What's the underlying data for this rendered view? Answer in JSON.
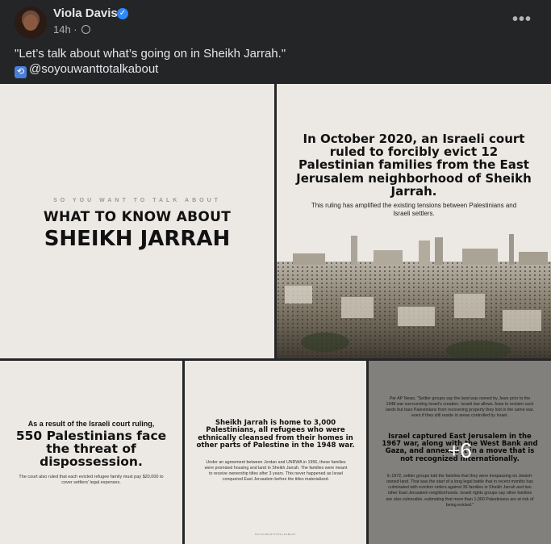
{
  "post": {
    "author": "Viola Davis",
    "time": "14h ·",
    "caption": "\"Let’s talk about what’s going on in Sheikh Jarrah.\"",
    "handle": "@soyouwanttotalkabout",
    "more_label": "•••"
  },
  "tiles": {
    "t1": {
      "kicker": "SO YOU WANT TO TALK ABOUT",
      "line1": "WHAT TO KNOW ABOUT",
      "line2": "SHEIKH JARRAH"
    },
    "t2": {
      "headline": "In October 2020, an Israeli court ruled to forcibly evict 12 Palestinian families from the East Jerusalem neighborhood of Sheikh Jarrah.",
      "sub": "This ruling has amplified the existing tensions between Palestinians and Israeli settlers."
    },
    "t3": {
      "intro": "As a result of the Israeli court ruling,",
      "headline": "550 Palestinians face the threat of dispossession.",
      "small": "The court also ruled that each evicted refugee family must pay $20,000 to cover settlers' legal expenses."
    },
    "t4": {
      "headline": "Sheikh Jarrah is home to 3,000 Palestinians, all refugees who were ethnically cleansed from their homes in other parts of Palestine in the 1948 war.",
      "small": "Under an agreement between Jordan and UNRWA in 1956, these families were promised housing and land in Sheikh Jarrah. The families were meant to receive ownership titles after 3 years. This never happened as Israel conquered East Jerusalem before the titles materialized.",
      "footer": "SOYOUWANTTOTALKABOUT"
    },
    "t5": {
      "top": "Per AP News, \"Settler groups say the land was owned by Jews prior to the 1948 war surrounding Israel's creation. Israeli law allows Jews to reclaim such lands but bars Palestinians from recovering property they lost in the same war, even if they still reside in areas controlled by Israel.",
      "headline": "Israel captured East Jerusalem in the 1967 war, along with the West Bank and Gaza, and annexed it in a move that is not recognized internationally.",
      "bottom": "In 1972, settler groups told the families that they were trespassing on Jewish-owned land. That was the start of a long legal battle that in recent months has culminated with eviction orders against 36 families in Sheikh Jarrah and two other East Jerusalem neighborhoods. Israeli rights groups say other families are also vulnerable, estimating that more than 1,000 Palestinians are at risk of being evicted.\"",
      "more_count": "+6"
    }
  }
}
